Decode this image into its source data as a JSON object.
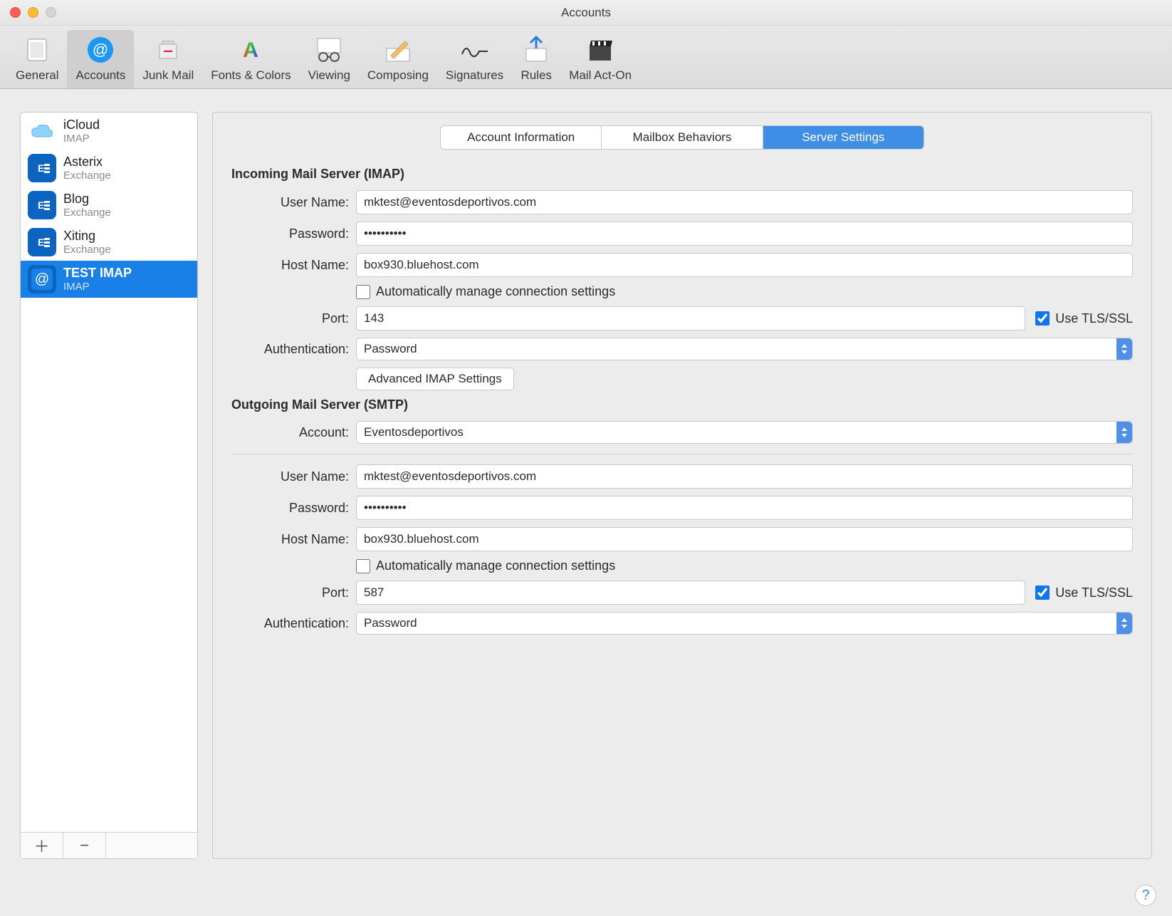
{
  "window": {
    "title": "Accounts"
  },
  "toolbar": {
    "items": [
      {
        "label": "General"
      },
      {
        "label": "Accounts"
      },
      {
        "label": "Junk Mail"
      },
      {
        "label": "Fonts & Colors"
      },
      {
        "label": "Viewing"
      },
      {
        "label": "Composing"
      },
      {
        "label": "Signatures"
      },
      {
        "label": "Rules"
      },
      {
        "label": "Mail Act-On"
      }
    ]
  },
  "sidebar": {
    "accounts": [
      {
        "name": "iCloud",
        "protocol": "IMAP",
        "kind": "cloud"
      },
      {
        "name": "Asterix",
        "protocol": "Exchange",
        "kind": "exchange"
      },
      {
        "name": "Blog",
        "protocol": "Exchange",
        "kind": "exchange"
      },
      {
        "name": "Xiting",
        "protocol": "Exchange",
        "kind": "exchange"
      },
      {
        "name": "TEST IMAP",
        "protocol": "IMAP",
        "kind": "at"
      }
    ]
  },
  "tabs": {
    "items": [
      "Account Information",
      "Mailbox Behaviors",
      "Server Settings"
    ]
  },
  "incoming": {
    "heading": "Incoming Mail Server (IMAP)",
    "labels": {
      "user": "User Name:",
      "password": "Password:",
      "host": "Host Name:",
      "auto": "Automatically manage connection settings",
      "port": "Port:",
      "tls": "Use TLS/SSL",
      "auth": "Authentication:",
      "advanced": "Advanced IMAP Settings"
    },
    "values": {
      "user": "mktest@eventosdeportivos.com",
      "password": "••••••••••",
      "host": "box930.bluehost.com",
      "port": "143",
      "auth": "Password",
      "tls_checked": true,
      "auto_checked": false
    }
  },
  "outgoing": {
    "heading": "Outgoing Mail Server (SMTP)",
    "labels": {
      "account": "Account:",
      "user": "User Name:",
      "password": "Password:",
      "host": "Host Name:",
      "auto": "Automatically manage connection settings",
      "port": "Port:",
      "tls": "Use TLS/SSL",
      "auth": "Authentication:"
    },
    "values": {
      "account": "Eventosdeportivos",
      "user": "mktest@eventosdeportivos.com",
      "password": "••••••••••",
      "host": "box930.bluehost.com",
      "port": "587",
      "auth": "Password",
      "tls_checked": true,
      "auto_checked": false
    }
  },
  "help": "?"
}
